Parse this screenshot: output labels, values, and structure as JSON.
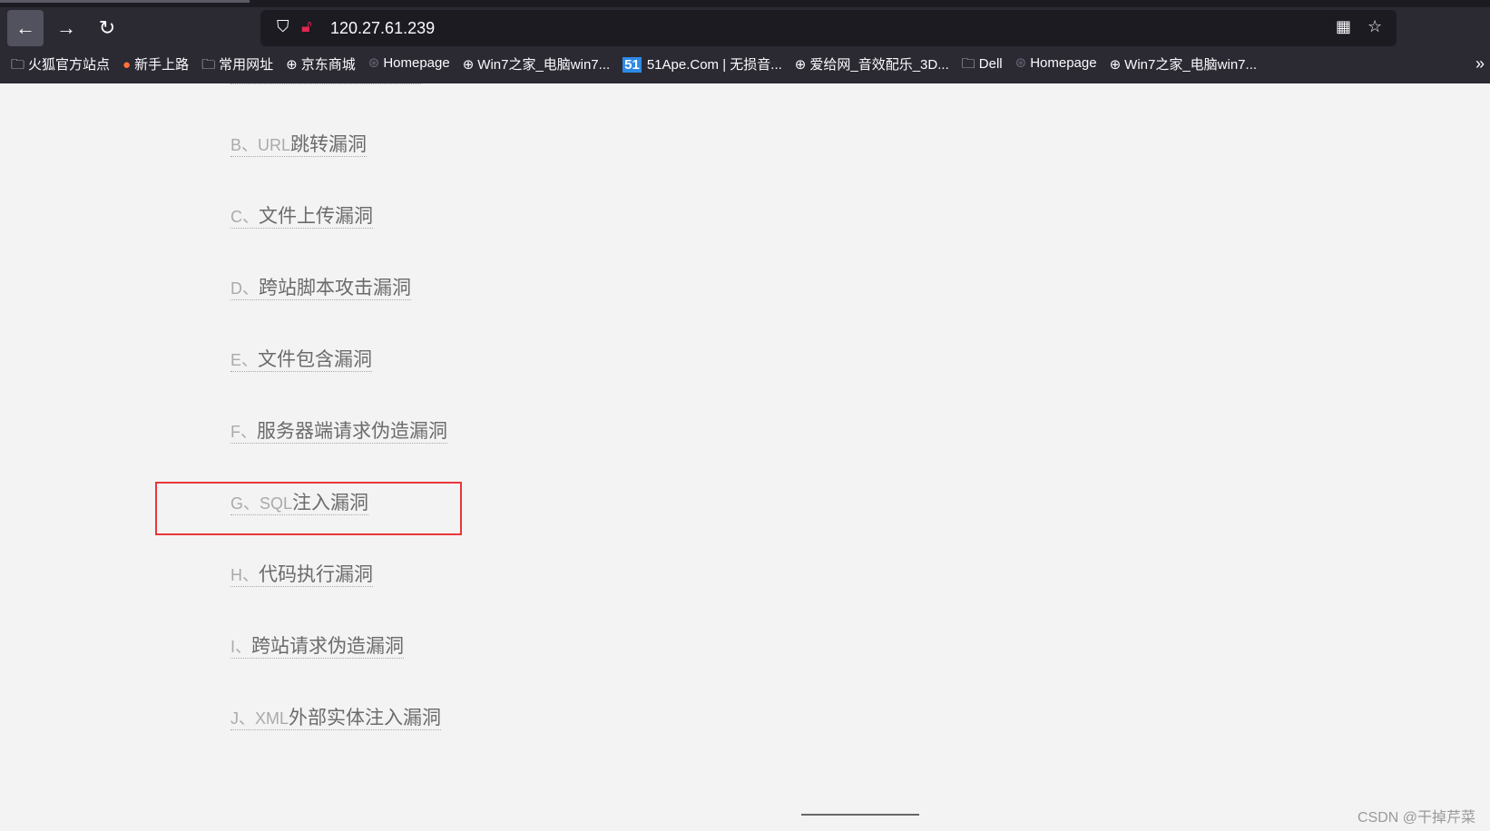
{
  "browser": {
    "url": "120.27.61.239",
    "bookmarks": [
      {
        "icon": "folder-icon",
        "label": "火狐官方站点"
      },
      {
        "icon": "firefox-icon",
        "label": "新手上路"
      },
      {
        "icon": "folder-icon",
        "label": "常用网址"
      },
      {
        "icon": "globe-icon",
        "label": "京东商城"
      },
      {
        "icon": "wordpress-icon",
        "label": "Homepage"
      },
      {
        "icon": "globe-icon",
        "label": "Win7之家_电脑win7..."
      },
      {
        "icon": "51-icon",
        "badge": "51",
        "label": "51Ape.Com | 无损音..."
      },
      {
        "icon": "globe-icon",
        "label": "爱给网_音效配乐_3D..."
      },
      {
        "icon": "folder-icon",
        "label": "Dell"
      },
      {
        "icon": "wordpress-icon",
        "label": "Homepage"
      },
      {
        "icon": "globe-icon",
        "label": "Win7之家_电脑win7..."
      }
    ]
  },
  "list": [
    {
      "prefix": "B、URL",
      "text": "跳转漏洞"
    },
    {
      "prefix": "C、",
      "text": "文件上传漏洞"
    },
    {
      "prefix": "D、",
      "text": "跨站脚本攻击漏洞"
    },
    {
      "prefix": "E、",
      "text": "文件包含漏洞"
    },
    {
      "prefix": "F、",
      "text": "服务器端请求伪造漏洞"
    },
    {
      "prefix": "G、SQL",
      "text": "注入漏洞"
    },
    {
      "prefix": "H、",
      "text": "代码执行漏洞"
    },
    {
      "prefix": "I、",
      "text": "跨站请求伪造漏洞"
    },
    {
      "prefix": "J、XML",
      "text": "外部实体注入漏洞"
    }
  ],
  "highlight_color": "#e8373a",
  "watermark": "CSDN @干掉芹菜"
}
